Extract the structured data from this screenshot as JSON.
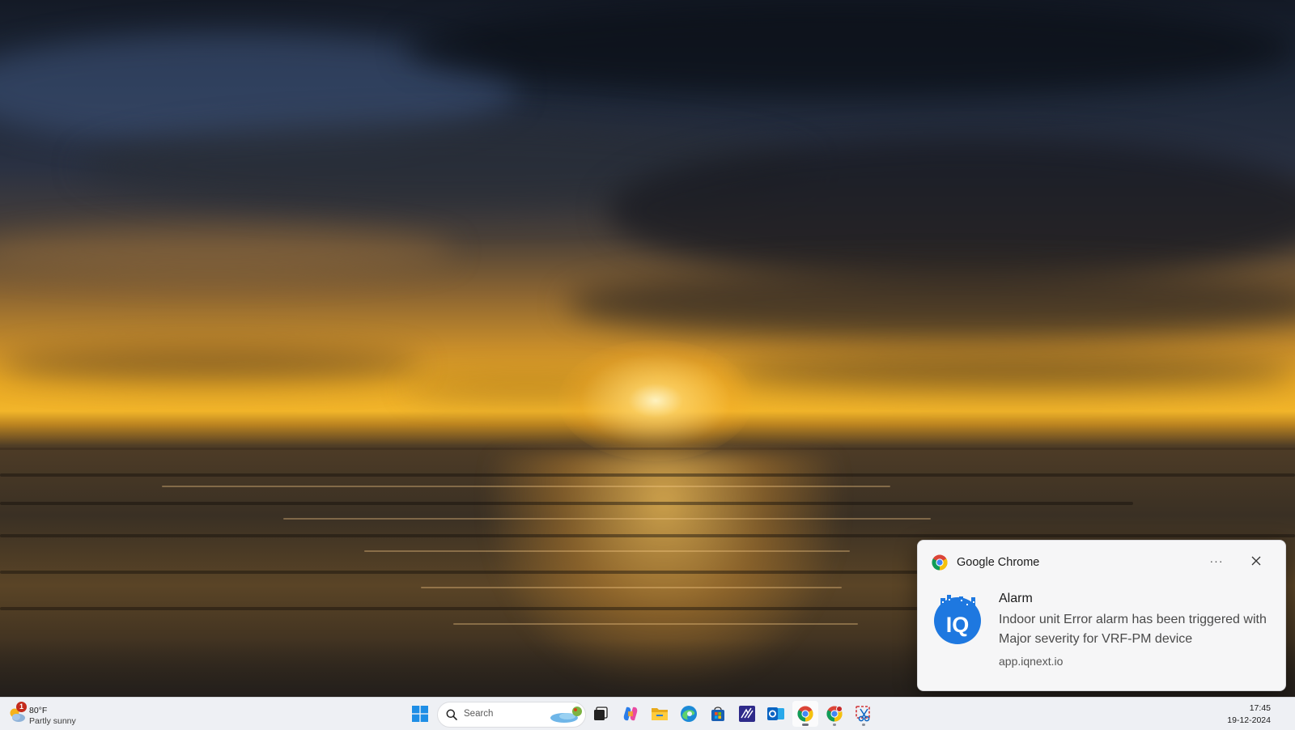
{
  "notification": {
    "app_name": "Google Chrome",
    "more_label": "···",
    "title": "Alarm",
    "body": "Indoor unit Error alarm has been triggered with Major severity for VRF-PM device",
    "source": "app.iqnext.io",
    "icon_text": "IQ"
  },
  "taskbar": {
    "weather": {
      "badge": "1",
      "temperature": "80°F",
      "condition": "Partly sunny"
    },
    "search": {
      "placeholder": "Search"
    },
    "apps": [
      {
        "name": "Start",
        "icon": "windows-start-icon"
      },
      {
        "name": "Task View",
        "icon": "task-view-icon"
      },
      {
        "name": "Copilot",
        "icon": "copilot-icon"
      },
      {
        "name": "File Explorer",
        "icon": "file-explorer-icon"
      },
      {
        "name": "Microsoft Edge",
        "icon": "edge-icon"
      },
      {
        "name": "Microsoft Store",
        "icon": "store-icon"
      },
      {
        "name": "App",
        "icon": "app-icon"
      },
      {
        "name": "Outlook",
        "icon": "outlook-icon"
      },
      {
        "name": "Google Chrome",
        "icon": "chrome-icon"
      },
      {
        "name": "Google Chrome Profile",
        "icon": "chrome-profile-icon"
      },
      {
        "name": "Snipping Tool",
        "icon": "snipping-tool-icon"
      }
    ],
    "clock": {
      "time": "17:45",
      "date": "19-12-2024"
    }
  },
  "colors": {
    "toast_bg": "#f6f6f7",
    "taskbar_bg": "#eef0f4",
    "iq_blue": "#1e78e0",
    "badge_red": "#c42b1c"
  }
}
